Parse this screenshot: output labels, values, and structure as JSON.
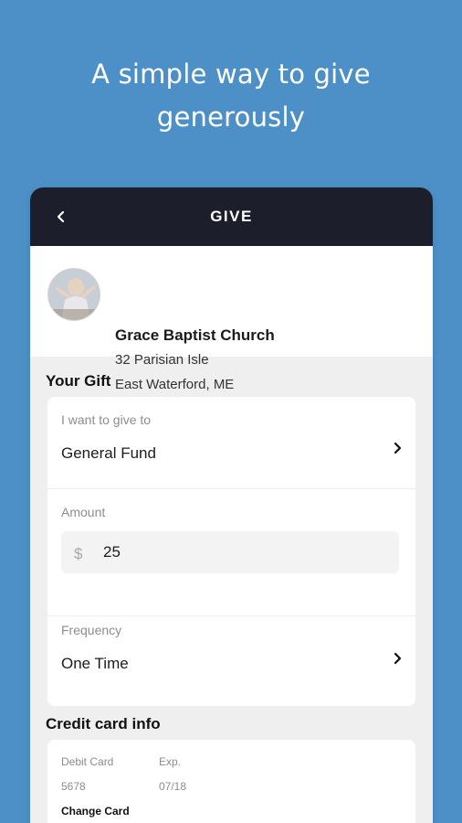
{
  "headline": {
    "line1": "A simple way to give",
    "line2": "generously"
  },
  "appbar": {
    "title": "GIVE",
    "back_icon": "chevron-left-icon"
  },
  "church": {
    "name": "Grace Baptist Church",
    "address_line1": "32 Parisian Isle",
    "address_line2": "East Waterford, ME"
  },
  "gift": {
    "section_title": "Your Gift",
    "give_to_label": "I want to give to",
    "give_to_value": "General Fund",
    "amount_label": "Amount",
    "currency_symbol": "$",
    "amount_value": "25",
    "frequency_label": "Frequency",
    "frequency_value": "One Time"
  },
  "credit_card": {
    "section_title": "Credit card info",
    "card_type_label": "Debit Card",
    "card_number": "5678",
    "exp_label": "Exp.",
    "exp_value": "07/18",
    "change_card_label": "Change Card"
  },
  "colors": {
    "background": "#4d90c8",
    "appbar": "#1c1e2b",
    "surface": "#ffffff",
    "panel": "#efefef"
  }
}
